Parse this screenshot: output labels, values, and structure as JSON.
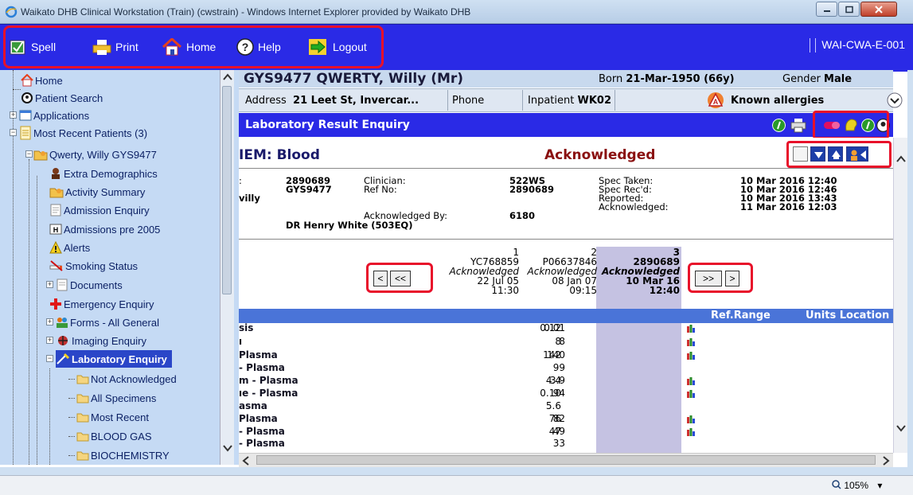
{
  "window": {
    "title": "Waikato DHB Clinical Workstation (Train) (cwstrain) - Windows Internet Explorer provided by Waikato DHB"
  },
  "toolbar": {
    "spell": "Spell",
    "print": "Print",
    "home": "Home",
    "help": "Help",
    "logout": "Logout",
    "workstation": "WAI-CWA-E-001"
  },
  "tree": {
    "items": [
      {
        "label": "Home",
        "icon": "home-icon"
      },
      {
        "label": "Patient Search",
        "icon": "search-person-icon"
      },
      {
        "label": "Applications",
        "icon": "applications-icon"
      },
      {
        "label": "Most Recent Patients (3)",
        "icon": "patients-icon"
      },
      {
        "label": "Qwerty, Willy GYS9477",
        "icon": "patient-folder-icon"
      },
      {
        "label": "Extra Demographics",
        "icon": "demographics-icon"
      },
      {
        "label": "Activity Summary",
        "icon": "activity-icon"
      },
      {
        "label": "Admission Enquiry",
        "icon": "document-icon"
      },
      {
        "label": "Admissions pre 2005",
        "icon": "admissions-icon"
      },
      {
        "label": "Alerts",
        "icon": "alert-icon"
      },
      {
        "label": "Smoking Status",
        "icon": "smoking-icon"
      },
      {
        "label": "Documents",
        "icon": "documents-icon"
      },
      {
        "label": "Emergency Enquiry",
        "icon": "emergency-icon"
      },
      {
        "label": "Forms - All General",
        "icon": "forms-icon"
      },
      {
        "label": "Imaging Enquiry",
        "icon": "imaging-icon"
      },
      {
        "label": "Laboratory Enquiry",
        "icon": "lab-icon"
      },
      {
        "label": "Not Acknowledged",
        "icon": "folder-icon"
      },
      {
        "label": "All Specimens",
        "icon": "folder-icon"
      },
      {
        "label": "Most Recent",
        "icon": "folder-icon"
      },
      {
        "label": "BLOOD GAS",
        "icon": "folder-icon"
      },
      {
        "label": "BIOCHEMISTRY",
        "icon": "folder-icon"
      }
    ]
  },
  "patient": {
    "name": "GYS9477  QWERTY, Willy (Mr)",
    "born_label": "Born",
    "born_value": "21-Mar-1950 (66y)",
    "gender_label": "Gender",
    "gender_value": "Male",
    "address_label": "Address",
    "address_value": "21 Leet St, Invercar...",
    "phone_label": "Phone",
    "inpatient_label": "Inpatient",
    "inpatient_value": "WK02",
    "allergies": "Known allergies"
  },
  "panel": {
    "title": "Laboratory Result Enquiry"
  },
  "result": {
    "item": "IEM: Blood",
    "status": "Acknowledged",
    "details": {
      "colon": ":",
      "id": "2890689",
      "nhi": "GYS9477",
      "name_frag": "villy",
      "clinician_label": "Clinician:",
      "clinician": "522WS",
      "refno_label": "Ref No:",
      "refno": "2890689",
      "ackby_label": "Acknowledged By:",
      "ackby": "6180",
      "doctor": "DR Henry White (503EQ)",
      "spec_taken_label": "Spec Taken:",
      "spec_taken": "10 Mar 2016 12:40",
      "spec_recd_label": "Spec Rec'd:",
      "spec_recd": "10 Mar 2016 12:46",
      "reported_label": "Reported:",
      "reported": "10 Mar 2016 13:43",
      "acknowledged_label": "Acknowledged:",
      "acknowledged": "11 Mar 2016 12:03"
    },
    "columns": [
      {
        "num": "1",
        "ref": "YC768859",
        "status": "Acknowledged",
        "date": "22 Jul 05",
        "time": "11:30"
      },
      {
        "num": "2",
        "ref": "P06637846",
        "status": "Acknowledged",
        "date": "08 Jan 07",
        "time": "09:15"
      },
      {
        "num": "3",
        "ref": "2890689",
        "status": "Acknowledged",
        "date": "10 Mar 16",
        "time": "12:40"
      }
    ],
    "nav": {
      "prev": "<",
      "first": "<<",
      "next": ">>",
      "last": ">"
    },
    "table_headers": {
      "ref_range": "Ref.Range",
      "units_location": "Units Location"
    },
    "rows": [
      {
        "name": "sis",
        "v1": "0.12",
        "v2": "0.01",
        "chart": true
      },
      {
        "name": "ı",
        "v1": "8",
        "v2": "8",
        "chart": true
      },
      {
        "name": " Plasma",
        "v1": "142",
        "v2": "140",
        "chart": true
      },
      {
        "name": "- Plasma",
        "v1": "",
        "v2": "99",
        "chart": false
      },
      {
        "name": "m - Plasma",
        "v1": "4.4",
        "v2": "3.9",
        "chart": true
      },
      {
        "name": "ıe - Plasma",
        "v1": "0.10",
        "v2": "94",
        "chart": true
      },
      {
        "name": "asma",
        "v1": "5.6",
        "v2": "",
        "chart": false
      },
      {
        "name": " Plasma",
        "v1": "76",
        "v2": "82",
        "chart": true
      },
      {
        "name": "- Plasma",
        "v1": "47",
        "v2": "49",
        "chart": true
      },
      {
        "name": "- Plasma",
        "v1": "",
        "v2": "33",
        "chart": false
      }
    ]
  },
  "statusbar": {
    "zoom": "105%"
  }
}
